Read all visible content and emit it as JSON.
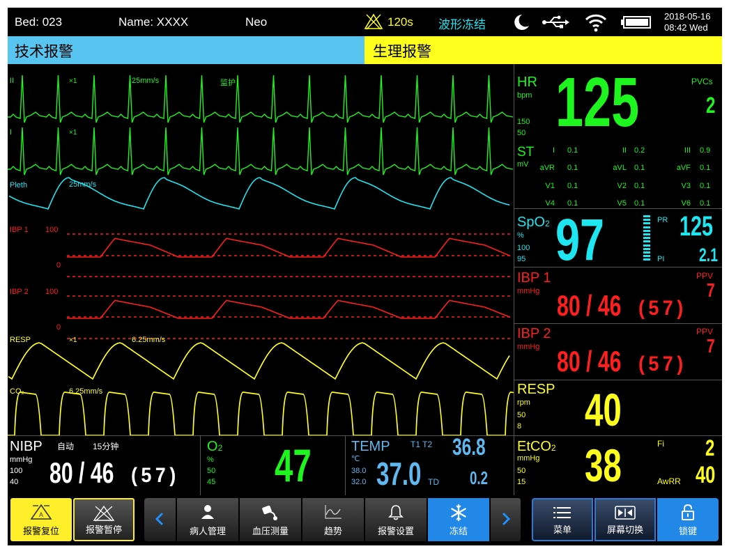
{
  "topbar": {
    "bed": "Bed: 023",
    "name": "Name: XXXX",
    "patient_type": "Neo",
    "alarm_silence_time": "120s",
    "freeze_status": "波形冻结",
    "date": "2018-05-16",
    "time": "08:42 Wed"
  },
  "alarms": {
    "technical": "技术报警",
    "physiological": "生理报警"
  },
  "waves": {
    "ecg2": {
      "lead": "II",
      "gain": "×1",
      "speed": "25mm/s",
      "mode": "监护"
    },
    "ecg1": {
      "lead": "I",
      "gain": "×1"
    },
    "pleth": {
      "label": "Pleth",
      "speed": "25mm/s"
    },
    "ibp1": {
      "label": "IBP 1",
      "top": "100",
      "bottom": "0"
    },
    "ibp2": {
      "label": "IBP 2",
      "top": "100",
      "bottom": "0"
    },
    "resp": {
      "label": "RESP",
      "gain": "×1",
      "speed": "6.25mm/s"
    },
    "co2": {
      "label": "CO₂",
      "speed": "6.25mm/s"
    }
  },
  "colors": {
    "ecg": "#1ef51e",
    "spo2": "#1ee6f0",
    "ibp": "#ff1e1e",
    "resp": "#ffff1e"
  },
  "hr": {
    "label": "HR",
    "unit": "bpm",
    "high": "150",
    "low": "50",
    "value": "125",
    "pvcs_label": "PVCs",
    "pvcs": "2"
  },
  "st": {
    "label": "ST",
    "unit": "mV",
    "rows": [
      [
        {
          "lead": "I",
          "v": "0.1"
        },
        {
          "lead": "II",
          "v": "0.2"
        },
        {
          "lead": "III",
          "v": "0.9"
        }
      ],
      [
        {
          "lead": "aVR",
          "v": "0.1"
        },
        {
          "lead": "aVL",
          "v": "0.1"
        },
        {
          "lead": "aVF",
          "v": "0.1"
        }
      ],
      [
        {
          "lead": "V1",
          "v": "0.1"
        },
        {
          "lead": "V2",
          "v": "0.1"
        },
        {
          "lead": "V3",
          "v": "0.1"
        }
      ],
      [
        {
          "lead": "V4",
          "v": "0.1"
        },
        {
          "lead": "V5",
          "v": "0.1"
        },
        {
          "lead": "V6",
          "v": "0.1"
        }
      ]
    ]
  },
  "spo2": {
    "label": "SpO",
    "sub": "2",
    "unit": "%",
    "high": "100",
    "low": "95",
    "value": "97",
    "pr_label": "PR",
    "pr": "125",
    "pi_label": "PI",
    "pi": "2.1"
  },
  "ibp1": {
    "label": "IBP 1",
    "unit": "mmHg",
    "value": "80 / 46",
    "mean": "(57)",
    "ppv_label": "PPV",
    "ppv": "7"
  },
  "ibp2": {
    "label": "IBP 2",
    "unit": "mmHg",
    "value": "80 / 46",
    "mean": "(57)",
    "ppv_label": "PPV",
    "ppv": "7"
  },
  "resp": {
    "label": "RESP",
    "unit": "rpm",
    "high": "50",
    "low": "8",
    "value": "40"
  },
  "nibp": {
    "label": "NIBP",
    "mode": "自动",
    "interval": "15分钟",
    "unit": "mmHg",
    "high": "100",
    "low": "40",
    "value": "80 / 46",
    "mean": "(57)"
  },
  "o2": {
    "label": "O",
    "sub": "2",
    "unit": "%",
    "high": "50",
    "low": "45",
    "value": "47"
  },
  "temp": {
    "label": "TEMP",
    "unit": "℃",
    "t1t2_label": "T1  T2",
    "t1t2": "36.8",
    "high": "38.0",
    "low": "32.0",
    "value": "37.0",
    "td_label": "TD",
    "td": "0.2"
  },
  "etco2": {
    "label": "EtCO",
    "sub": "2",
    "unit": "mmHg",
    "high": "50",
    "low": "15",
    "value": "38",
    "fi_label": "Fi",
    "fi": "2",
    "awrr_label": "AwRR",
    "awrr": "40"
  },
  "buttons": {
    "alarm_reset": "报警复位",
    "alarm_pause": "报警暂停",
    "patient": "病人管理",
    "nibp": "血压测量",
    "trend": "趋势",
    "alarm_setup": "报警设置",
    "freeze": "冻结",
    "menu": "菜单",
    "screen": "屏幕切换",
    "lock": "锁键"
  }
}
